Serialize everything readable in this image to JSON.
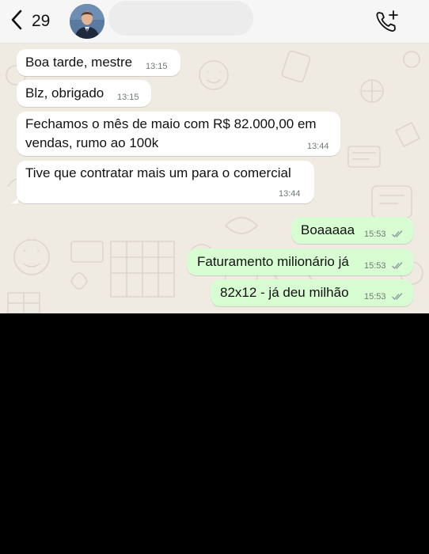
{
  "header": {
    "back_count": "29",
    "contact_name": "",
    "icons": {
      "back": "chevron-left-icon",
      "call": "add-call-icon",
      "avatar": "contact-photo"
    }
  },
  "messages": [
    {
      "direction": "incoming",
      "text": "Boa tarde, mestre",
      "time": "13:15"
    },
    {
      "direction": "incoming",
      "text": "Blz, obrigado",
      "time": "13:15"
    },
    {
      "direction": "incoming",
      "text_lines": [
        "Fechamos o mês de maio com R$ 82.000,00 em",
        "vendas, rumo ao 100k"
      ],
      "time": "13:44"
    },
    {
      "direction": "incoming",
      "text": "Tive que contratar mais um para o comercial",
      "time": "13:44"
    },
    {
      "direction": "outgoing",
      "text": "Boaaaaa",
      "time": "15:53",
      "status": "read"
    },
    {
      "direction": "outgoing",
      "text": "Faturamento milionário já",
      "time": "15:53",
      "status": "read"
    },
    {
      "direction": "outgoing",
      "text": "82x12 - já deu milhão",
      "time": "15:53",
      "status": "read"
    }
  ],
  "colors": {
    "chat_background": "#efeae2",
    "incoming_bubble": "#ffffff",
    "outgoing_bubble": "#d9fdd3",
    "header_background": "#f6f6f6",
    "read_ticks": "#8696a0"
  }
}
